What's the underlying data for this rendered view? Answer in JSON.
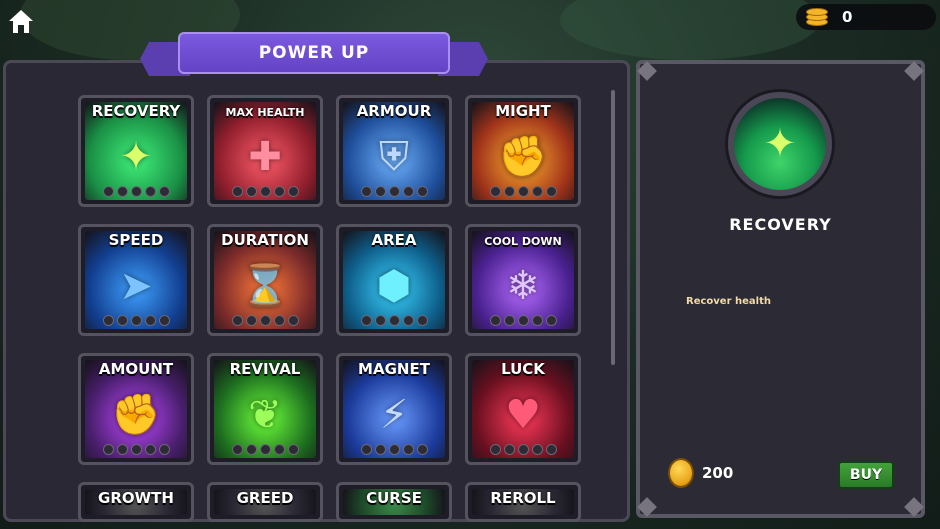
{
  "currency": {
    "amount": "0"
  },
  "title": "POWER UP",
  "powerups": [
    {
      "label": "RECOVERY",
      "small": false,
      "bg": "#1a8f45",
      "glow": "#3ff07a",
      "glyph": "✦",
      "glyph_color": "#d9ff6b"
    },
    {
      "label": "MAX HEALTH",
      "small": true,
      "bg": "#8f1e2c",
      "glow": "#ff5c6a",
      "glyph": "✚",
      "glyph_color": "#ff8ea0"
    },
    {
      "label": "ARMOUR",
      "small": false,
      "bg": "#1e4e9a",
      "glow": "#6fb2ff",
      "glyph": "⛨",
      "glyph_color": "#bcd8ff"
    },
    {
      "label": "MIGHT",
      "small": false,
      "bg": "#a0331a",
      "glow": "#ffb02e",
      "glyph": "✊",
      "glyph_color": "#ff6a3a"
    },
    {
      "label": "SPEED",
      "small": false,
      "bg": "#123e8f",
      "glow": "#3fa2ff",
      "glyph": "➤",
      "glyph_color": "#7cc4ff"
    },
    {
      "label": "DURATION",
      "small": false,
      "bg": "#7a2a2a",
      "glow": "#ff7a3a",
      "glyph": "⌛",
      "glyph_color": "#ffcf8a"
    },
    {
      "label": "AREA",
      "small": false,
      "bg": "#0e5e8a",
      "glow": "#3ad4ff",
      "glyph": "⬢",
      "glyph_color": "#6ff0ff"
    },
    {
      "label": "COOL DOWN",
      "small": true,
      "bg": "#4a2190",
      "glow": "#b56bff",
      "glyph": "❄",
      "glyph_color": "#e0c6ff"
    },
    {
      "label": "AMOUNT",
      "small": false,
      "bg": "#4a1f6e",
      "glow": "#c04aff",
      "glyph": "✊",
      "glyph_color": "#ffd1b8"
    },
    {
      "label": "REVIVAL",
      "small": false,
      "bg": "#1d6e1f",
      "glow": "#6dff3a",
      "glyph": "❦",
      "glyph_color": "#9cff5a"
    },
    {
      "label": "MAGNET",
      "small": false,
      "bg": "#1b3a9a",
      "glow": "#6a9cff",
      "glyph": "⚡",
      "glyph_color": "#c6dcff"
    },
    {
      "label": "LUCK",
      "small": false,
      "bg": "#6a1020",
      "glow": "#ff3a5a",
      "glyph": "♥",
      "glyph_color": "#ff5a78"
    },
    {
      "label": "GROWTH",
      "small": false,
      "bg": "#2a2834",
      "glow": "#555",
      "glyph": "",
      "glyph_color": "#fff"
    },
    {
      "label": "GREED",
      "small": false,
      "bg": "#2a2834",
      "glow": "#555",
      "glyph": "",
      "glyph_color": "#fff"
    },
    {
      "label": "CURSE",
      "small": false,
      "bg": "#1e4a2a",
      "glow": "#3a8a4a",
      "glyph": "",
      "glyph_color": "#fff"
    },
    {
      "label": "REROLL",
      "small": false,
      "bg": "#2a2834",
      "glow": "#555",
      "glyph": "",
      "glyph_color": "#fff"
    }
  ],
  "detail": {
    "title": "RECOVERY",
    "description": "Recover health",
    "price": "200",
    "buy_label": "BUY"
  },
  "colors": {
    "panel": "#2a2834",
    "ribbon": "#6443c6",
    "buy": "#2a7a28",
    "coin": "#f4b526"
  }
}
